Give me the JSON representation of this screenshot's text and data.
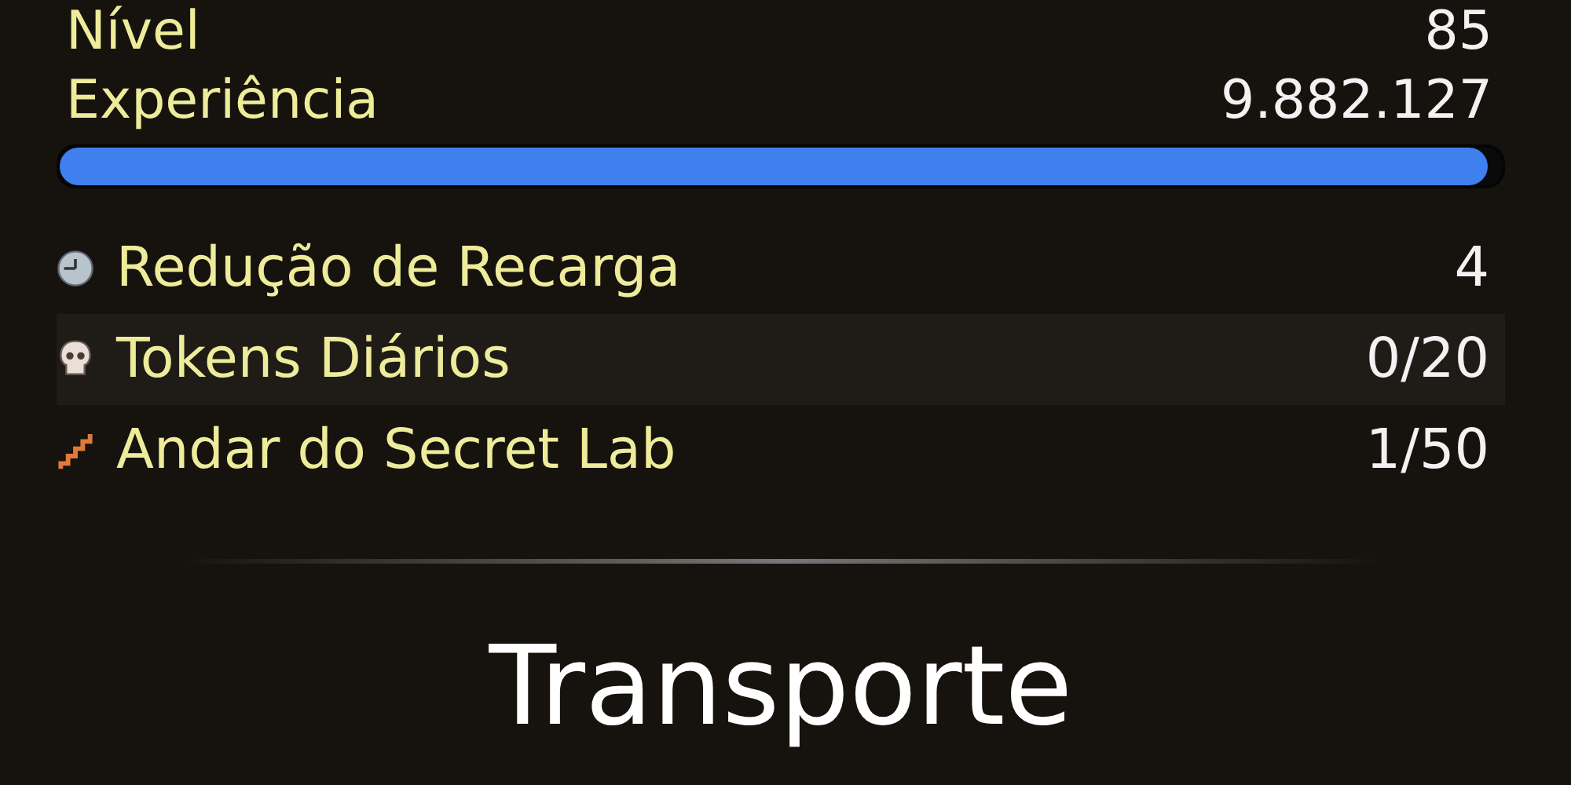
{
  "stats": [
    {
      "label": "Nível",
      "value": "85"
    },
    {
      "label": "Experiência",
      "value": "9.882.127"
    }
  ],
  "experience_bar": {
    "level": 0.99
  },
  "counters": [
    {
      "kind": "clock",
      "label": "Redução de Recarga",
      "value": "4"
    },
    {
      "kind": "skull",
      "label": "Tokens Diários",
      "value": "0/20"
    },
    {
      "kind": "stairs",
      "label": "Andar do Secret Lab",
      "value": "1/50"
    }
  ],
  "section_title": "Transporte"
}
